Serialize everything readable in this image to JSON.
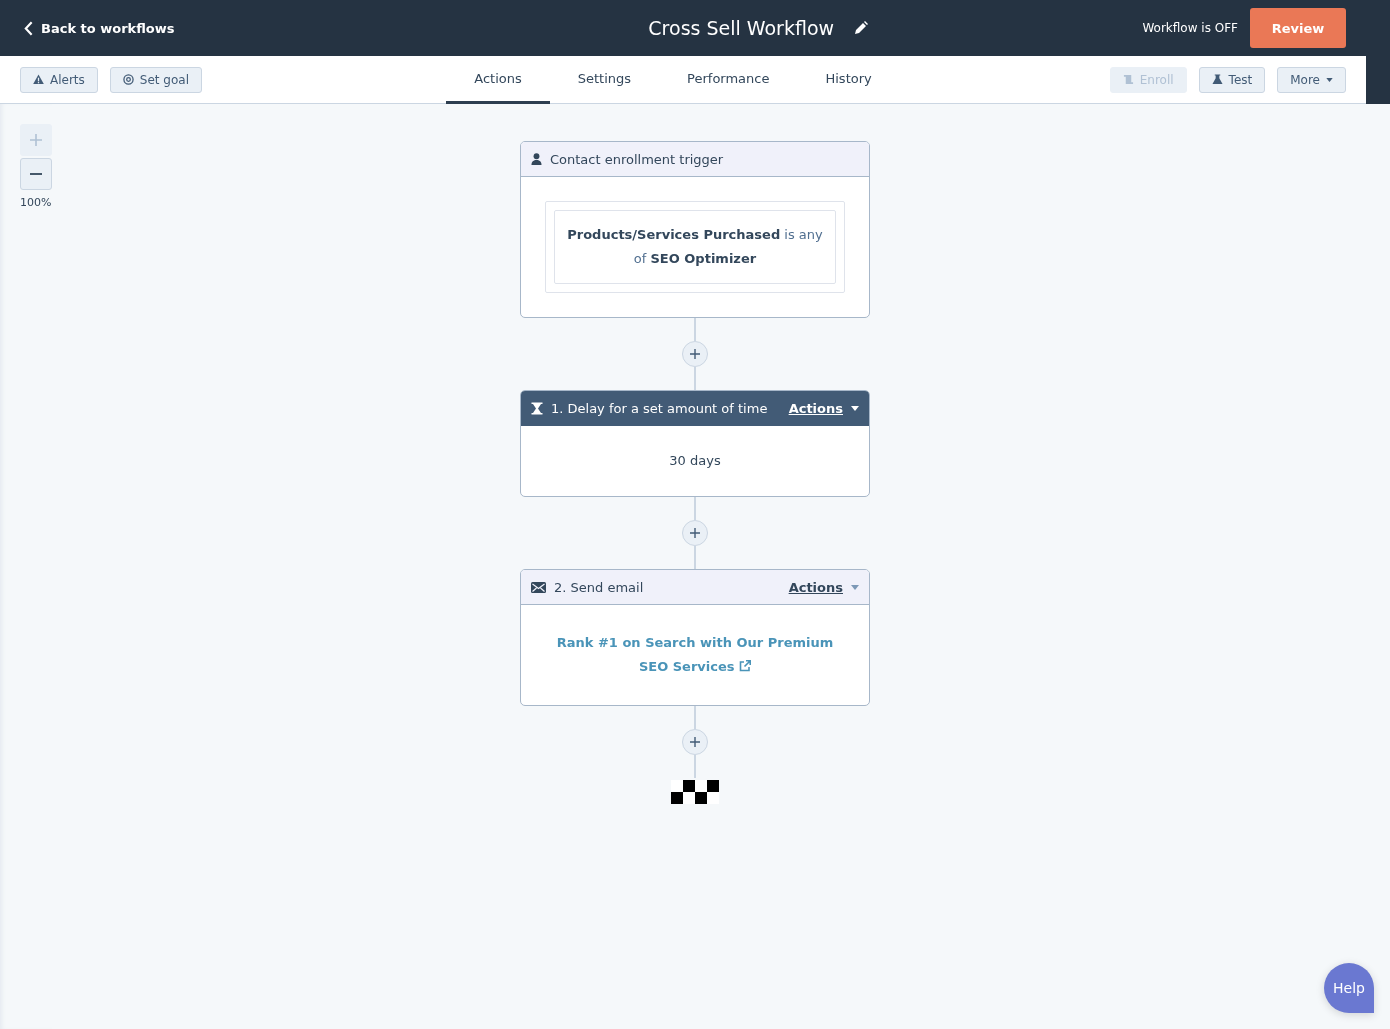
{
  "header": {
    "back_link": "Back to workflows",
    "title": "Cross Sell Workflow",
    "status_text": "Workflow is OFF",
    "review_button": "Review"
  },
  "toolbar": {
    "left_buttons": [
      {
        "label": "Alerts",
        "kind": "alert"
      },
      {
        "label": "Set goal",
        "kind": "goal"
      }
    ],
    "tabs": [
      {
        "label": "Actions",
        "selected": true
      },
      {
        "label": "Settings",
        "selected": false
      },
      {
        "label": "Performance",
        "selected": false
      },
      {
        "label": "History",
        "selected": false
      }
    ],
    "right_buttons": [
      {
        "label": "Enroll",
        "kind": "enroll",
        "disabled": true
      },
      {
        "label": "Test",
        "kind": "test",
        "disabled": false
      },
      {
        "label": "More",
        "kind": "menu",
        "disabled": false
      }
    ]
  },
  "zoom": {
    "zoom_in_disabled": true,
    "level_text": "100%"
  },
  "trigger": {
    "title": "Contact enrollment trigger",
    "condition": "**Products/Services Purchased** is any of **SEO Optimizer**"
  },
  "actions": [
    {
      "kind": "delay",
      "title": "1. Delay for a set amount of time",
      "menu": "Actions",
      "selected": true,
      "body": "30 days"
    },
    {
      "kind": "email",
      "title": "2. Send email",
      "menu": "Actions",
      "selected": false,
      "body": "Rank #1 on Search with Our Premium SEO Services"
    }
  ],
  "help_button": "Help"
}
